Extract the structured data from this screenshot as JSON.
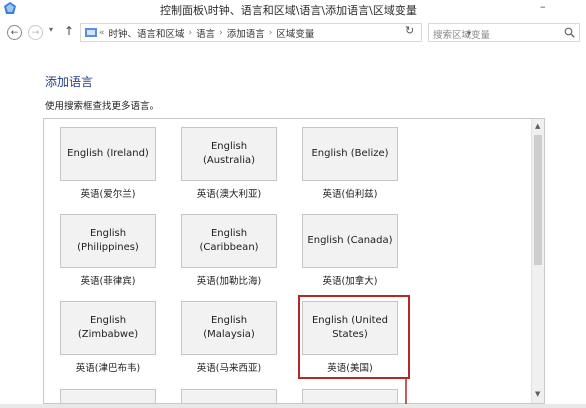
{
  "window": {
    "title": "控制面板\\时钟、语言和区域\\语言\\添加语言\\区域变量",
    "minimize_glyph": "–"
  },
  "addressbar": {
    "back_glyph": "←",
    "forward_glyph": "→",
    "dropdown_glyph": "▾",
    "up_glyph": "↑",
    "crumb_prefix": "«",
    "crumbs": [
      "时钟、语言和区域",
      "语言",
      "添加语言",
      "区域变量"
    ],
    "separator": "›",
    "crumb_dropdown_glyph": "▾",
    "refresh_glyph": "↻",
    "search_placeholder": "搜索区域变量"
  },
  "content": {
    "title": "添加语言",
    "description": "使用搜索框查找更多语言。"
  },
  "languages": [
    {
      "name": "English (Ireland)",
      "label": "英语(爱尔兰)"
    },
    {
      "name": "English (Australia)",
      "label": "英语(澳大利亚)"
    },
    {
      "name": "English (Belize)",
      "label": "英语(伯利兹)"
    },
    {
      "name": "English (Philippines)",
      "label": "英语(菲律宾)"
    },
    {
      "name": "English (Caribbean)",
      "label": "英语(加勒比海)"
    },
    {
      "name": "English (Canada)",
      "label": "英语(加拿大)"
    },
    {
      "name": "English (Zimbabwe)",
      "label": "英语(津巴布韦)"
    },
    {
      "name": "English (Malaysia)",
      "label": "英语(马来西亚)"
    },
    {
      "name": "English (United States)",
      "label": "英语(美国)"
    }
  ],
  "scrollbar": {
    "up_glyph": "▲",
    "down_glyph": "▼"
  },
  "colors": {
    "title_blue": "#1f3f86",
    "highlight_red": "#b42828",
    "tile_bg": "#f2f2f2"
  },
  "icons": {
    "app": "control-panel-icon",
    "breadcrumb": "control-panel-icon",
    "search": "search-icon"
  }
}
